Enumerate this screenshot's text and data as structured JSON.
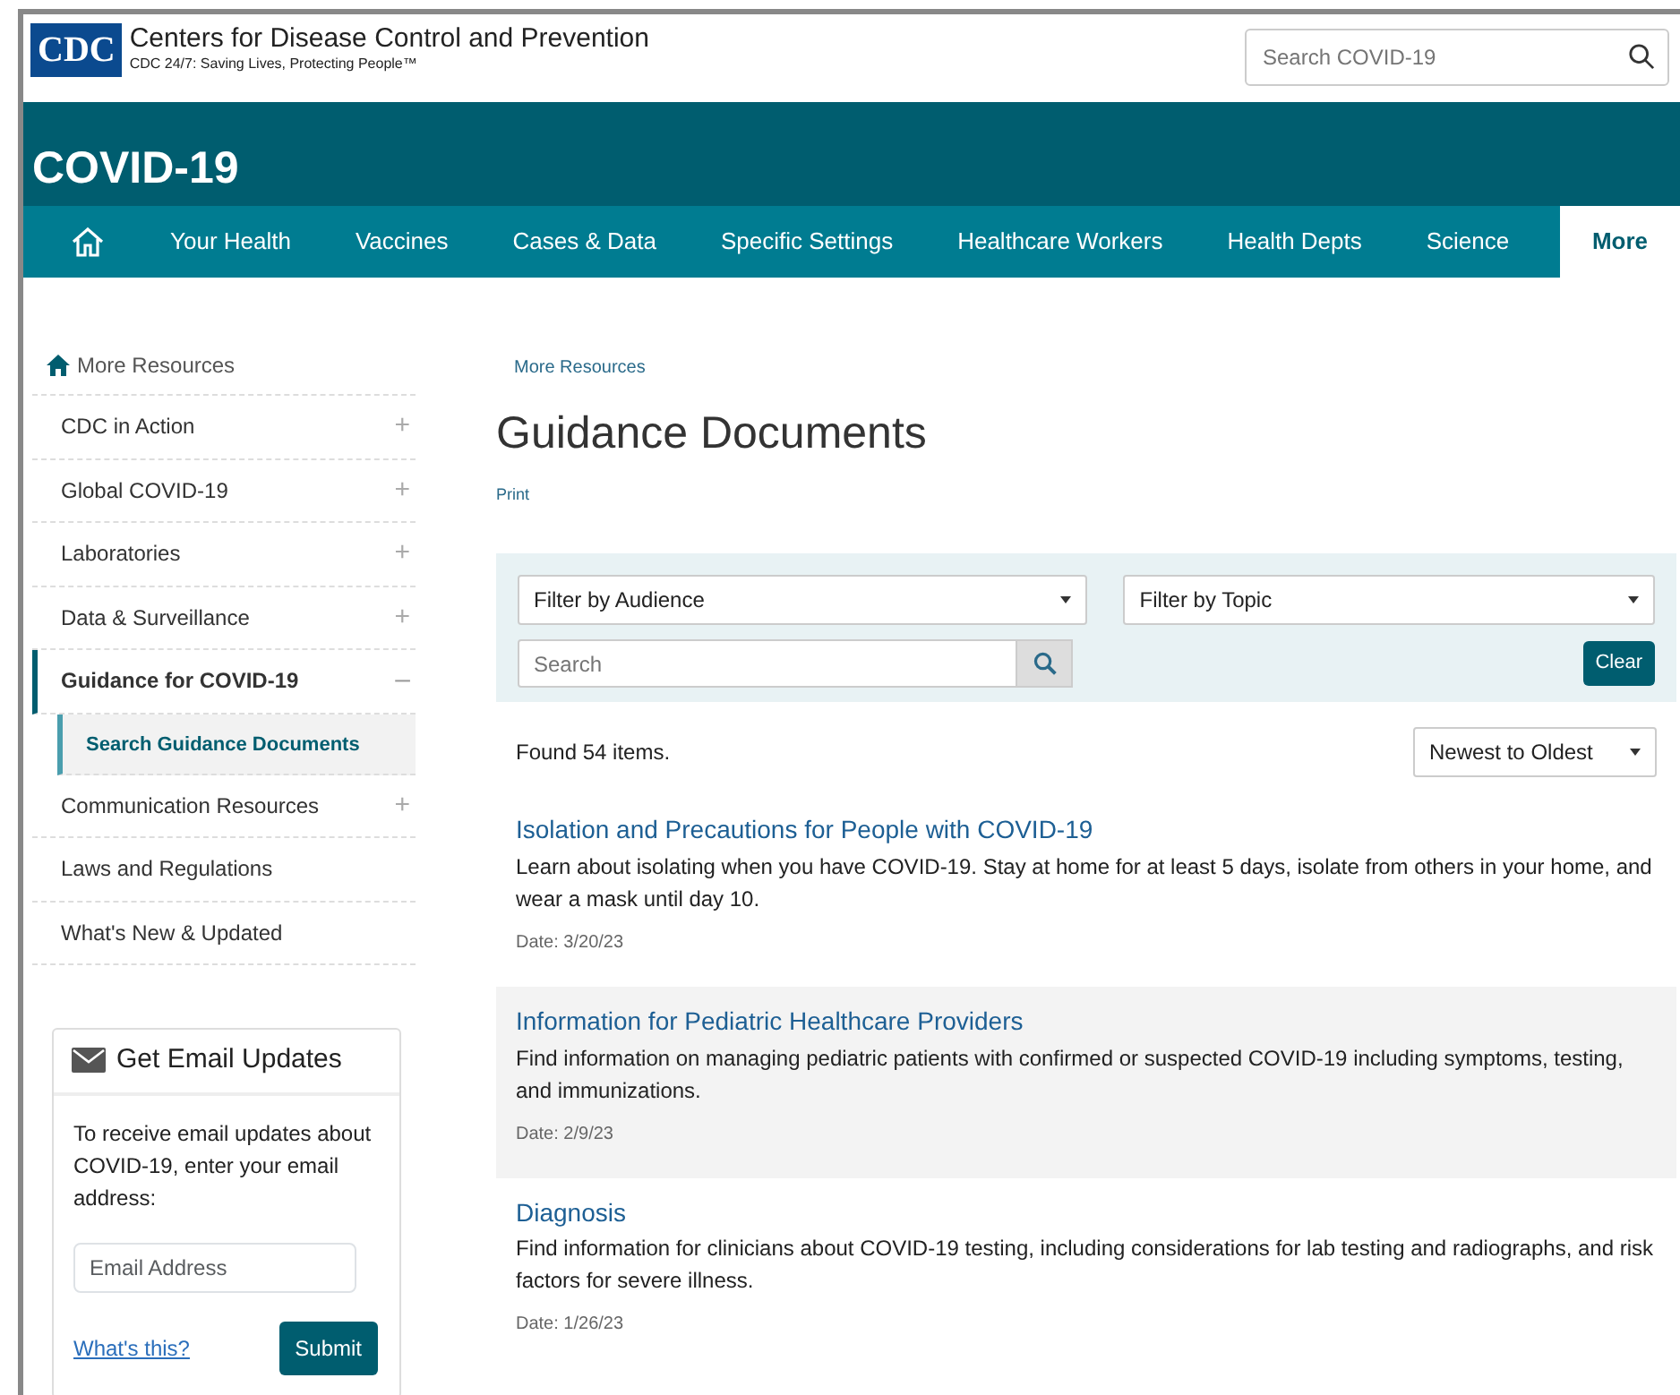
{
  "header": {
    "logo": "CDC",
    "org_name": "Centers for Disease Control and Prevention",
    "tagline": "CDC 24/7: Saving Lives, Protecting People™",
    "search": {
      "placeholder": "Search COVID-19"
    }
  },
  "site_title": "COVID-19",
  "nav": [
    {
      "kind": "home",
      "selected": false
    },
    {
      "kind": "link",
      "label": "Your Health",
      "selected": false
    },
    {
      "kind": "link",
      "label": "Vaccines",
      "selected": false
    },
    {
      "kind": "link",
      "label": "Cases & Data",
      "selected": false
    },
    {
      "kind": "link",
      "label": "Specific Settings",
      "selected": false
    },
    {
      "kind": "link",
      "label": "Healthcare Workers",
      "selected": false
    },
    {
      "kind": "link",
      "label": "Health Depts",
      "selected": false
    },
    {
      "kind": "link",
      "label": "Science",
      "selected": false
    },
    {
      "kind": "link",
      "label": "More",
      "selected": true
    }
  ],
  "sidebar": {
    "home": "More Resources",
    "items": [
      {
        "label": "CDC in Action",
        "toggle": "+",
        "expanded": false,
        "selected": false
      },
      {
        "label": "Global COVID-19",
        "toggle": "+",
        "expanded": false,
        "selected": false
      },
      {
        "label": "Laboratories",
        "toggle": "+",
        "expanded": false,
        "selected": false
      },
      {
        "label": "Data & Surveillance",
        "toggle": "+",
        "expanded": false,
        "selected": false
      },
      {
        "label": "Guidance for COVID-19",
        "toggle": "–",
        "expanded": true,
        "selected": true,
        "children": [
          {
            "label": "Search Guidance Documents",
            "selected": true
          }
        ]
      },
      {
        "label": "Communication Resources",
        "toggle": "+",
        "expanded": false,
        "selected": false
      },
      {
        "label": "Laws and Regulations",
        "selected": false
      },
      {
        "label": "What's New & Updated",
        "selected": false
      }
    ]
  },
  "email_box": {
    "title": "Get Email Updates",
    "text": "To receive email updates about COVID-19, enter your email address:",
    "placeholder": "Email Address",
    "link": "What's this?",
    "button": "Submit"
  },
  "breadcrumb": "More Resources",
  "page_title": "Guidance Documents",
  "print": "Print",
  "filters": {
    "audience": "Filter by Audience",
    "topic": "Filter by Topic",
    "search_placeholder": "Search",
    "clear": "Clear"
  },
  "found": "Found 54 items.",
  "sort": "Newest to Oldest",
  "results": [
    {
      "title": "Isolation and Precautions for People with COVID-19",
      "text": "Learn about isolating when you have COVID-19. Stay at home for at least 5 days, isolate from others in your home, and wear a mask until day 10.",
      "date": "Date: 3/20/23",
      "highlighted": false
    },
    {
      "title": "Information for Pediatric Healthcare Providers",
      "text": "Find information on managing pediatric patients with confirmed or suspected COVID-19 including symptoms, testing, and immunizations.",
      "date": "Date: 2/9/23",
      "highlighted": true
    },
    {
      "title": "Diagnosis",
      "text": "Find information for clinicians about COVID-19 testing, including considerations for lab testing and radiographs, and risk factors for severe illness.",
      "date": "Date: 1/26/23",
      "highlighted": false
    }
  ]
}
